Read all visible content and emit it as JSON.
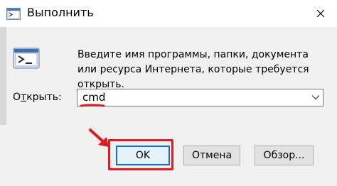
{
  "window": {
    "title": "Выполнить",
    "icon": "run-app-icon",
    "close_icon": "close-icon"
  },
  "description": "Введите имя программы, папки, документа или ресурса Интернета, которые требуется открыть.",
  "open_field": {
    "label_prefix": "О",
    "label_underlined": "т",
    "label_rest": "крыть:",
    "value": "cmd"
  },
  "buttons": {
    "ok": "OK",
    "cancel": "Отмена",
    "browse": "Обзор..."
  },
  "annotation_color": "#e11b22",
  "accent_color": "#0078d7"
}
